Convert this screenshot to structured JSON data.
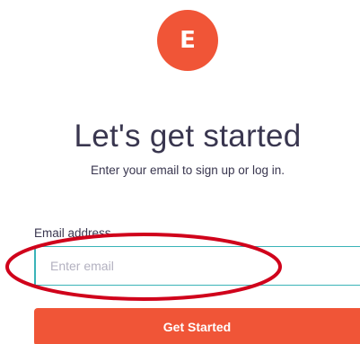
{
  "logo": {
    "letter": "E"
  },
  "title": "Let's get started",
  "subtitle": "Enter your email to sign up or log in.",
  "email": {
    "label": "Email address",
    "placeholder": "Enter email",
    "value": ""
  },
  "cta": {
    "label": "Get Started"
  },
  "colors": {
    "brand": "#f05537",
    "focus_border": "#3ab3b8",
    "annotation": "#d0021b",
    "text": "#39364f"
  }
}
